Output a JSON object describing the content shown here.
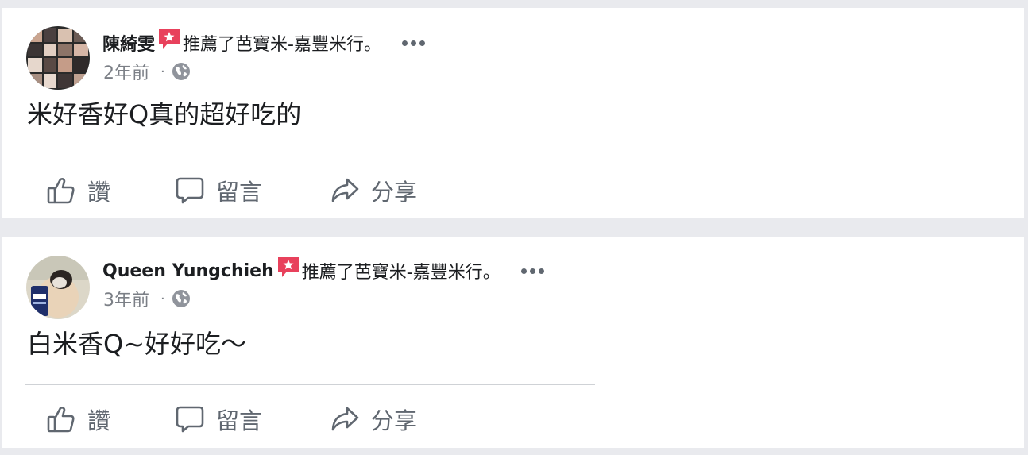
{
  "posts": [
    {
      "author": "陳綺雯",
      "action": "推薦了芭寶米-嘉豐米行。",
      "time": "2年前",
      "separator": "·",
      "body": "米好香好Q真的超好吃的",
      "buttons": {
        "like": "讚",
        "comment": "留言",
        "share": "分享"
      },
      "icons": {
        "recommend": "recommend-icon",
        "privacy": "globe-icon",
        "more": "more-icon"
      }
    },
    {
      "author": "Queen Yungchieh",
      "action": "推薦了芭寶米-嘉豐米行。",
      "time": "3年前",
      "separator": "·",
      "body": "白米香Q~好好吃～",
      "buttons": {
        "like": "讚",
        "comment": "留言",
        "share": "分享"
      },
      "icons": {
        "recommend": "recommend-icon",
        "privacy": "globe-icon",
        "more": "more-icon"
      }
    }
  ],
  "colors": {
    "page_background": "#e9eaee",
    "card_background": "#ffffff",
    "recommend_red": "#e8415c",
    "secondary_text": "#606770"
  }
}
